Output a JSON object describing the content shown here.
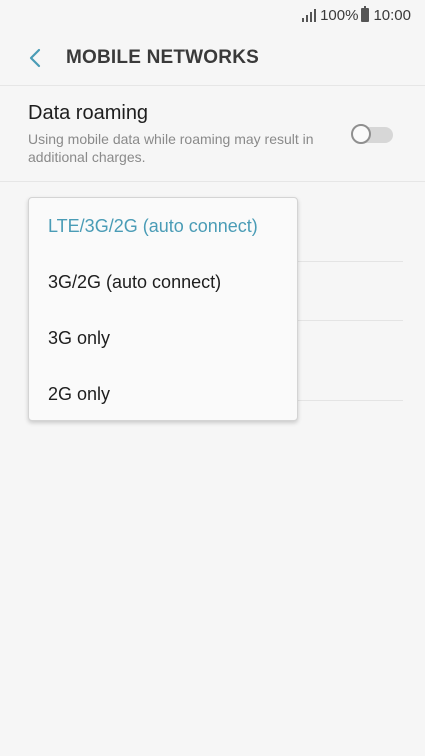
{
  "status_bar": {
    "battery": "100%",
    "time": "10:00"
  },
  "header": {
    "title": "MOBILE NETWORKS"
  },
  "data_roaming": {
    "title": "Data roaming",
    "subtitle": "Using mobile data while roaming may result in additional charges.",
    "enabled": false
  },
  "network_mode_menu": {
    "selected_index": 0,
    "options": [
      "LTE/3G/2G (auto connect)",
      "3G/2G (auto connect)",
      "3G only",
      "2G only"
    ]
  },
  "colors": {
    "accent": "#4a9cb6",
    "background": "#f6f6f6"
  }
}
